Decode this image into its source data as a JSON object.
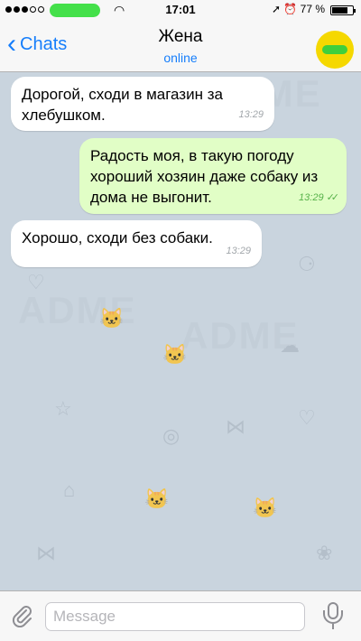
{
  "status_bar": {
    "time": "17:01",
    "battery_text": "77 %",
    "battery_level": 0.77,
    "signal_dots_filled": 3,
    "signal_dots_total": 5
  },
  "navbar": {
    "back_label": "Chats",
    "title": "Жена",
    "subtitle": "online"
  },
  "messages": [
    {
      "direction": "incoming",
      "text": "Дорогой, сходи в магазин за хлебушком.",
      "time": "13:29"
    },
    {
      "direction": "outgoing",
      "text": "Радость моя, в такую погоду хороший хозяин даже собаку из дома не выгонит.",
      "time": "13:29",
      "read_receipt": "✓✓"
    },
    {
      "direction": "incoming",
      "text": "Хорошо, сходи без собаки.",
      "time": "13:29"
    }
  ],
  "input": {
    "placeholder": "Message",
    "value": ""
  },
  "watermark": "ADME",
  "colors": {
    "accent": "#167efb",
    "outgoing_bubble": "#e1fec6",
    "incoming_bubble": "#ffffff",
    "chat_background": "#c9d4de",
    "avatar": "#f5d800"
  }
}
